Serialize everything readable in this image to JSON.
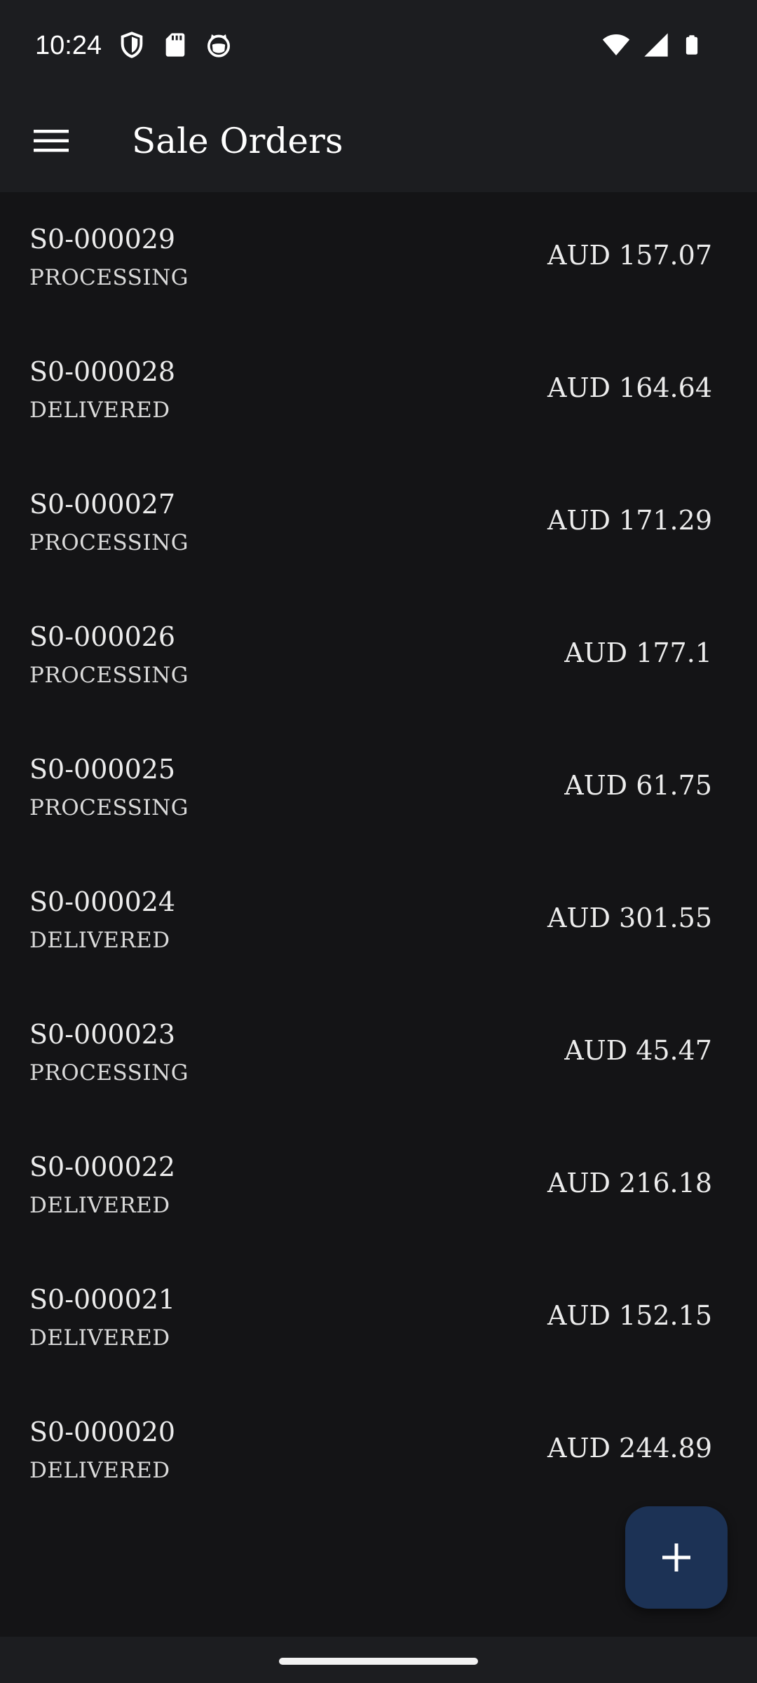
{
  "status_bar": {
    "time": "10:24",
    "left_icons": [
      "shield-icon",
      "sd-card-icon",
      "cat-face-icon"
    ],
    "right_icons": [
      "wifi-icon",
      "cellular-signal-icon",
      "battery-icon"
    ]
  },
  "app_bar": {
    "menu_icon": "hamburger-menu-icon",
    "title": "Sale Orders"
  },
  "orders": [
    {
      "id": "S0-000029",
      "status": "PROCESSING",
      "amount": "AUD 157.07"
    },
    {
      "id": "S0-000028",
      "status": "DELIVERED",
      "amount": "AUD 164.64"
    },
    {
      "id": "S0-000027",
      "status": "PROCESSING",
      "amount": "AUD 171.29"
    },
    {
      "id": "S0-000026",
      "status": "PROCESSING",
      "amount": "AUD 177.1"
    },
    {
      "id": "S0-000025",
      "status": "PROCESSING",
      "amount": "AUD 61.75"
    },
    {
      "id": "S0-000024",
      "status": "DELIVERED",
      "amount": "AUD 301.55"
    },
    {
      "id": "S0-000023",
      "status": "PROCESSING",
      "amount": "AUD 45.47"
    },
    {
      "id": "S0-000022",
      "status": "DELIVERED",
      "amount": "AUD 216.18"
    },
    {
      "id": "S0-000021",
      "status": "DELIVERED",
      "amount": "AUD 152.15"
    },
    {
      "id": "S0-000020",
      "status": "DELIVERED",
      "amount": "AUD 244.89"
    }
  ],
  "fab": {
    "icon": "plus-icon"
  },
  "colors": {
    "background": "#141416",
    "app_bar": "#1c1d20",
    "fab": "#1c3255",
    "text_primary": "#ececec"
  }
}
